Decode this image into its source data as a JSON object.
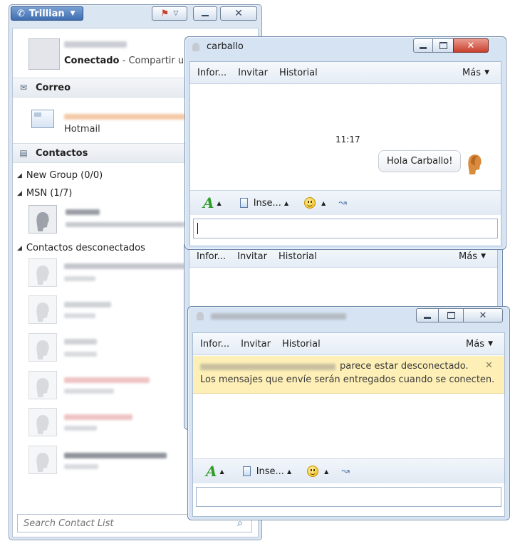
{
  "contact_list": {
    "app_name": "Trillian",
    "status_bold": "Conectado",
    "status_extra": "- Compartir un",
    "sections": {
      "mail": "Correo",
      "contacts": "Contactos"
    },
    "mail_account": "Hotmail",
    "groups": {
      "new_group": "New Group (0/0)",
      "msn": "MSN (1/7)",
      "offline": "Contactos desconectados"
    },
    "search_placeholder": "Search Contact List"
  },
  "chat_main": {
    "title": "carballo",
    "menu": [
      "Infor...",
      "Invitar",
      "Historial"
    ],
    "more": "Más",
    "timestamp": "11:17",
    "message": "Hola Carballo!",
    "insert_label": "Inse..."
  },
  "chat_back": {
    "menu": [
      "Infor...",
      "Invitar",
      "Historial"
    ],
    "more": "Más"
  },
  "chat_front": {
    "menu": [
      "Infor...",
      "Invitar",
      "Historial"
    ],
    "more": "Más",
    "notice_line1": "parece estar desconectado.",
    "notice_line2": "Los mensajes que envíe serán entregados cuando se conecten.",
    "insert_label": "Inse..."
  },
  "colors": {
    "notice_bg": "#fdefb6",
    "accent": "#3e6db0",
    "close_red": "#c9402d"
  }
}
